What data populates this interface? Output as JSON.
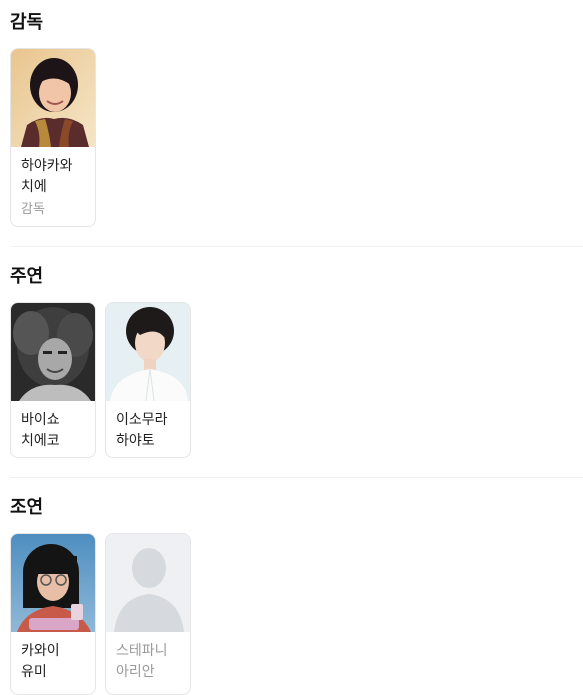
{
  "sections": [
    {
      "heading": "감독",
      "people": [
        {
          "name": "하야카와 치에",
          "role": "감독",
          "photo": "portrait-director"
        }
      ]
    },
    {
      "heading": "주연",
      "people": [
        {
          "name": "바이쇼 치에코",
          "role": "",
          "photo": "portrait-bw"
        },
        {
          "name": "이소무라 하야토",
          "role": "",
          "photo": "portrait-young-man"
        }
      ]
    },
    {
      "heading": "조연",
      "people": [
        {
          "name": "카와이 유미",
          "role": "",
          "photo": "portrait-phone"
        },
        {
          "name": "스테파니 아리안",
          "role": "",
          "photo": "placeholder-avatar-icon"
        }
      ]
    }
  ]
}
